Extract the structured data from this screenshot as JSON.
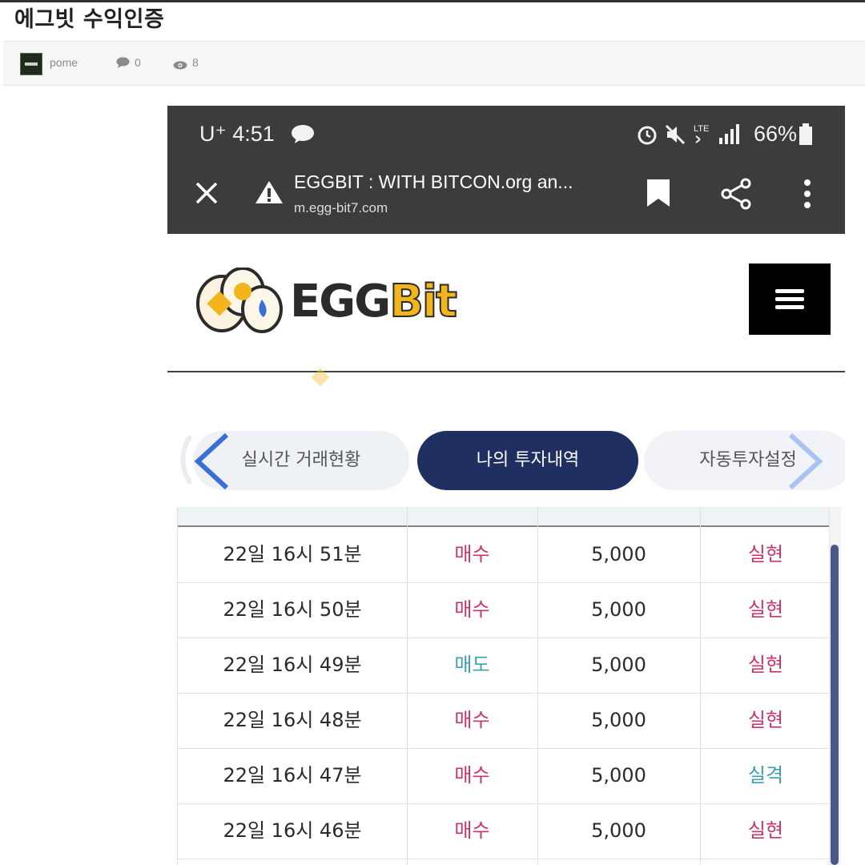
{
  "post": {
    "title": "에그빗 수익인증",
    "author": "pome",
    "comments": "0",
    "views": "8"
  },
  "status_bar": {
    "carrier_time": "U⁺ 4:51",
    "battery": "66%"
  },
  "browser": {
    "page_title": "EGGBIT : WITH BITCON.org an...",
    "url": "m.egg-bit7.com"
  },
  "site": {
    "logo_part1": "EGG",
    "logo_part2": "Bit"
  },
  "tabs": [
    {
      "label": "실시간 거래현황"
    },
    {
      "label": "나의 투자내역"
    },
    {
      "label": "자동투자설정"
    }
  ],
  "table": {
    "rows": [
      {
        "time": "22일 16시 51분",
        "side": "매수",
        "amount": "5,000",
        "result": "실현"
      },
      {
        "time": "22일 16시 50분",
        "side": "매수",
        "amount": "5,000",
        "result": "실현"
      },
      {
        "time": "22일 16시 49분",
        "side": "매도",
        "amount": "5,000",
        "result": "실현"
      },
      {
        "time": "22일 16시 48분",
        "side": "매수",
        "amount": "5,000",
        "result": "실현"
      },
      {
        "time": "22일 16시 47분",
        "side": "매수",
        "amount": "5,000",
        "result": "실격"
      },
      {
        "time": "22일 16시 46분",
        "side": "매수",
        "amount": "5,000",
        "result": "실현"
      }
    ]
  },
  "colors": {
    "buy": "#c9336b",
    "sell": "#3a9fae",
    "active_tab": "#1f2f61",
    "logo_yellow": "#f2b51d"
  }
}
